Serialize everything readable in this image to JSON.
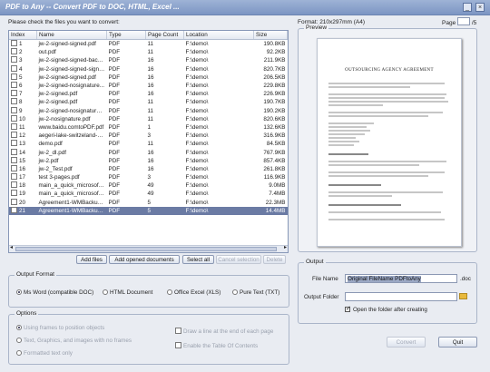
{
  "window": {
    "title": "PDF to Any  --  Convert PDF to DOC, HTML, Excel ..."
  },
  "instructions": "Please check the files you want to convert:",
  "columns": [
    "Index",
    "Name",
    "Type",
    "Page Count",
    "Location",
    "Size"
  ],
  "files": [
    {
      "index": "1",
      "name": "jw-2-signed-signed.pdf",
      "type": "PDF",
      "pages": "11",
      "location": "F:\\demo\\",
      "size": "190.8KB"
    },
    {
      "index": "2",
      "name": "out.pdf",
      "type": "PDF",
      "pages": "11",
      "location": "F:\\demo\\",
      "size": "92.2KB"
    },
    {
      "index": "3",
      "name": "jw-2-signed-signed-back...",
      "type": "PDF",
      "pages": "16",
      "location": "F:\\demo\\",
      "size": "211.9KB"
    },
    {
      "index": "4",
      "name": "jw-2-signed-signed-signe...",
      "type": "PDF",
      "pages": "16",
      "location": "F:\\demo\\",
      "size": "820.7KB"
    },
    {
      "index": "5",
      "name": "jw-2-signed-signed.pdf",
      "type": "PDF",
      "pages": "16",
      "location": "F:\\demo\\",
      "size": "206.5KB"
    },
    {
      "index": "6",
      "name": "jw-2-signed-nosignature...",
      "type": "PDF",
      "pages": "16",
      "location": "F:\\demo\\",
      "size": "229.8KB"
    },
    {
      "index": "7",
      "name": "jw-2-signed.pdf",
      "type": "PDF",
      "pages": "16",
      "location": "F:\\demo\\",
      "size": "226.9KB"
    },
    {
      "index": "8",
      "name": "jw-2-signed.pdf",
      "type": "PDF",
      "pages": "11",
      "location": "F:\\demo\\",
      "size": "190.7KB"
    },
    {
      "index": "9",
      "name": "jw-2-signed-nosignature.pdf",
      "type": "PDF",
      "pages": "11",
      "location": "F:\\demo\\",
      "size": "190.2KB"
    },
    {
      "index": "10",
      "name": "jw-2-nosignature.pdf",
      "type": "PDF",
      "pages": "11",
      "location": "F:\\demo\\",
      "size": "820.6KB"
    },
    {
      "index": "11",
      "name": "www.baidu.comtoPDF.pdf",
      "type": "PDF",
      "pages": "1",
      "location": "F:\\demo\\",
      "size": "132.6KB"
    },
    {
      "index": "12",
      "name": "aegeri-lake-switzeland-A...",
      "type": "PDF",
      "pages": "3",
      "location": "F:\\demo\\",
      "size": "316.9KB"
    },
    {
      "index": "13",
      "name": "demo.pdf",
      "type": "PDF",
      "pages": "11",
      "location": "F:\\demo\\",
      "size": "84.5KB"
    },
    {
      "index": "14",
      "name": "jw-2_dl.pdf",
      "type": "PDF",
      "pages": "16",
      "location": "F:\\demo\\",
      "size": "767.9KB"
    },
    {
      "index": "15",
      "name": "jw-2.pdf",
      "type": "PDF",
      "pages": "16",
      "location": "F:\\demo\\",
      "size": "857.4KB"
    },
    {
      "index": "16",
      "name": "jw-2_Test.pdf",
      "type": "PDF",
      "pages": "16",
      "location": "F:\\demo\\",
      "size": "261.8KB"
    },
    {
      "index": "17",
      "name": "test 3-pages.pdf",
      "type": "PDF",
      "pages": "3",
      "location": "F:\\demo\\",
      "size": "116.9KB"
    },
    {
      "index": "18",
      "name": "main_a_quick_microsoft_...",
      "type": "PDF",
      "pages": "49",
      "location": "F:\\demo\\",
      "size": "9.0MB"
    },
    {
      "index": "19",
      "name": "main_a_quick_microsoft_...",
      "type": "PDF",
      "pages": "49",
      "location": "F:\\demo\\",
      "size": "7.4MB"
    },
    {
      "index": "20",
      "name": "Agreement1-WMBackup-...",
      "type": "PDF",
      "pages": "5",
      "location": "F:\\demo\\",
      "size": "22.3MB"
    },
    {
      "index": "21",
      "name": "Agreement1-WMBackup-...",
      "type": "PDF",
      "pages": "5",
      "location": "F:\\demo\\",
      "size": "14.4MB",
      "selected": true
    }
  ],
  "buttons": {
    "add_files": "Add files",
    "add_opened": "Add opened documents",
    "select_all": "Select all",
    "cancel_selection": "Cancel selection",
    "delete": "Delete"
  },
  "output_format": {
    "legend": "Output Format",
    "options": [
      "Ms Word (compatible DOC)",
      "HTML Document",
      "Office Excel (XLS)",
      "Pure Text (TXT)"
    ],
    "selected": "Ms Word (compatible DOC)"
  },
  "options": {
    "legend": "Options",
    "left": [
      "Using frames to position objects",
      "Text, Graphics, and images with no frames",
      "Formatted text only"
    ],
    "right": [
      "Draw a line at the end of each page",
      "Enable the Table Of Contents"
    ]
  },
  "preview": {
    "format": "Format: 210x297mm (A4)",
    "page_label": "Page",
    "page_total": "/5",
    "legend": "Preview",
    "doc_title": "OUTSOURCING AGENCY AGREEMENT"
  },
  "output": {
    "legend": "Output",
    "file_name_label": "File Name",
    "file_name_value": "Original FileName PDFtoAny",
    "ext": ".doc",
    "folder_label": "Output Folder",
    "folder_value": "",
    "open_folder_label": "Open the folder after creating",
    "open_folder_checked": true
  },
  "actions": {
    "convert": "Convert",
    "quit": "Quit"
  }
}
